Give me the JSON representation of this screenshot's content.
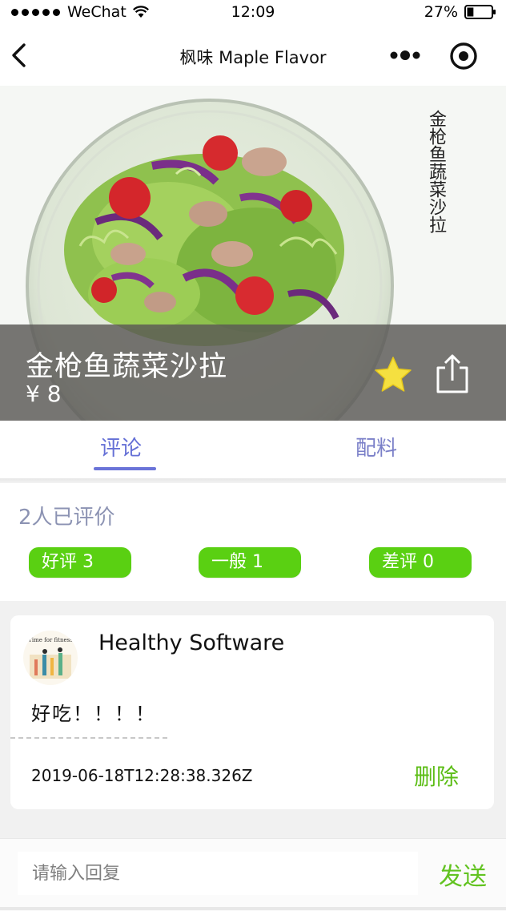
{
  "status_bar": {
    "carrier": "WeChat",
    "time": "12:09",
    "battery": "27%",
    "battery_level": 0.27
  },
  "nav": {
    "title": "枫味 Maple Flavor"
  },
  "dish": {
    "name": "金枪鱼蔬菜沙拉",
    "price": "¥ 8",
    "image_text": "金枪鱼蔬菜沙拉"
  },
  "tabs": [
    {
      "label": "评论",
      "active": true
    },
    {
      "label": "配料",
      "active": false
    }
  ],
  "ratings": {
    "count_label": "2人已评价",
    "pills": [
      {
        "label": "好评 3"
      },
      {
        "label": "一般 1"
      },
      {
        "label": "差评 0"
      }
    ]
  },
  "comments": [
    {
      "user": "Healthy Software",
      "avatar_text": "Time for fitness",
      "text": "好吃！！！！",
      "time": "2019-06-18T12:28:38.326Z",
      "delete_label": "删除"
    }
  ],
  "reply": {
    "placeholder": "请输入回复",
    "send_label": "发送"
  },
  "colors": {
    "accent": "#6570d6",
    "green": "#5ad012",
    "caption_overlay": "#5a5856",
    "star": "#f5e040"
  }
}
